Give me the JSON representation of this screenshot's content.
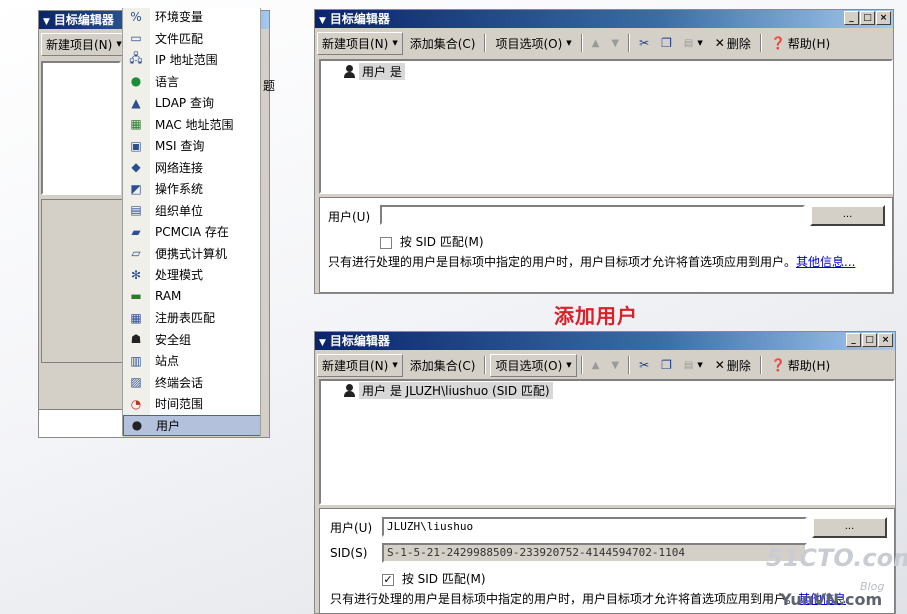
{
  "left_window": {
    "title": "目标编辑器",
    "toolbar_new_item": "新建项目(N)",
    "partial_text": "题"
  },
  "menu": {
    "items": [
      {
        "label": "环境变量",
        "icon": "percent-icon"
      },
      {
        "label": "文件匹配",
        "icon": "file-icon"
      },
      {
        "label": "IP 地址范围",
        "icon": "network-icon"
      },
      {
        "label": "语言",
        "icon": "globe-icon"
      },
      {
        "label": "LDAP 查询",
        "icon": "ldap-icon"
      },
      {
        "label": "MAC 地址范围",
        "icon": "network-card-icon"
      },
      {
        "label": "MSI 查询",
        "icon": "installer-icon"
      },
      {
        "label": "网络连接",
        "icon": "network-connection-icon"
      },
      {
        "label": "操作系统",
        "icon": "os-icon"
      },
      {
        "label": "组织单位",
        "icon": "ou-icon"
      },
      {
        "label": "PCMCIA 存在",
        "icon": "pcmcia-icon"
      },
      {
        "label": "便携式计算机",
        "icon": "laptop-icon"
      },
      {
        "label": "处理模式",
        "icon": "processing-mode-icon"
      },
      {
        "label": "RAM",
        "icon": "ram-icon"
      },
      {
        "label": "注册表匹配",
        "icon": "registry-icon"
      },
      {
        "label": "安全组",
        "icon": "security-group-icon"
      },
      {
        "label": "站点",
        "icon": "site-icon"
      },
      {
        "label": "终端会话",
        "icon": "terminal-session-icon"
      },
      {
        "label": "时间范围",
        "icon": "clock-icon"
      },
      {
        "label": "用户",
        "icon": "user-icon"
      }
    ]
  },
  "top_window": {
    "title": "目标编辑器",
    "toolbar": {
      "new_item": "新建项目(N)",
      "add_collection": "添加集合(C)",
      "item_options": "项目选项(O)",
      "delete": "删除",
      "help": "帮助(H)"
    },
    "node_label": "用户 是",
    "form": {
      "user_label": "用户(U)",
      "user_value": "",
      "browse": "...",
      "check_label": "按 SID 匹配(M)",
      "checked": false,
      "info_text": "只有进行处理的用户是目标项中指定的用户时，用户目标项才允许将首选项应用到用户。",
      "more_info": "其他信息..."
    }
  },
  "heading": "添加用户",
  "bottom_window": {
    "title": "目标编辑器",
    "toolbar": {
      "new_item": "新建项目(N)",
      "add_collection": "添加集合(C)",
      "item_options": "项目选项(O)",
      "delete": "删除",
      "help": "帮助(H)"
    },
    "node_label": "用户 是 JLUZH\\liushuo (SID 匹配)",
    "form": {
      "user_label": "用户(U)",
      "user_value": "JLUZH\\liushuo",
      "browse": "...",
      "sid_label": "SID(S)",
      "sid_value": "S-1-5-21-2429988509-233920752-4144594702-1104",
      "check_label": "按 SID 匹配(M)",
      "checked": true,
      "info_text": "只有进行处理的用户是目标项中指定的用户时，用户目标项才允许将首选项应用到用户。",
      "more_info": "其他信息"
    }
  },
  "watermark": {
    "brand": "51CTO.com",
    "blog": "Blog",
    "site": "YunVN.com"
  }
}
